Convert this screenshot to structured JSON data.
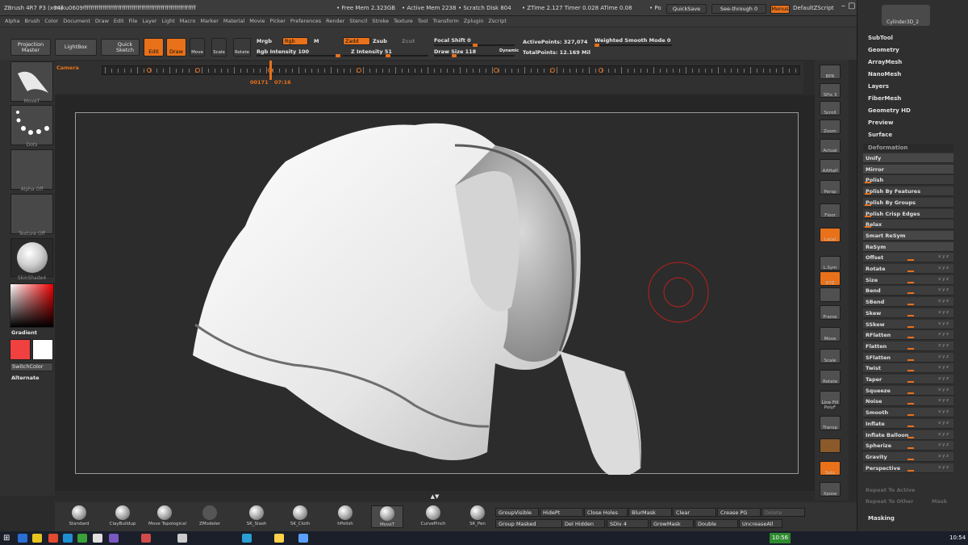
{
  "titlebar": {
    "app": "ZBrush 4R7 P3 (x64)",
    "doc": "miku0609ffffffffffffffffffffffffffffffffffffffffffffffffffffffffff",
    "free_mem": "• Free Mem 2.323GB",
    "active_mem": "• Active Mem 2238",
    "scratch": "• Scratch Disk 804",
    "ztime": "• ZTime 2.127 Timer 0.028 ATime 0.08",
    "po": "• Po",
    "quicksave": "QuickSave",
    "seethrough": "See-through  0",
    "menus": "Menus",
    "defaultzscript": "DefaultZScript",
    "tool_name": "Cylinder3D_2"
  },
  "menubar": [
    "Alpha",
    "Brush",
    "Color",
    "Document",
    "Draw",
    "Edit",
    "File",
    "Layer",
    "Light",
    "Macro",
    "Marker",
    "Material",
    "Movie",
    "Picker",
    "Preferences",
    "Render",
    "Stencil",
    "Stroke",
    "Texture",
    "Tool",
    "Transform",
    "Zplugin",
    "Zscript"
  ],
  "shelf": {
    "projection_master": "Projection Master",
    "lightbox": "LightBox",
    "quick_sketch": "Quick Sketch",
    "edit": "Edit",
    "draw": "Draw",
    "move": "Move",
    "scale": "Scale",
    "rotate": "Rotate",
    "mrgb": "Mrgb",
    "rgb": "Rgb",
    "m": "M",
    "rgb_intensity": "Rgb Intensity 100",
    "zadd": "Zadd",
    "zsub": "Zsub",
    "zcut": "Zcut",
    "z_intensity": "Z Intensity 51",
    "focal_shift": "Focal Shift 0",
    "draw_size": "Draw Size 118",
    "dynamic": "Dynamic",
    "active_points": "ActivePoints: 327,074",
    "total_points": "TotalPoints: 12.169 Mil",
    "weighted_smooth": "Weighted Smooth Mode 0"
  },
  "timeline": {
    "camera": "Camera",
    "frame": "00171",
    "time": "07:16"
  },
  "left": {
    "brush_cap": "MoveT",
    "stroke_cap": "Dots",
    "alpha_cap": "Alpha Off",
    "texture_cap": "Texture Off",
    "material_cap": "SkinShade4",
    "gradient": "Gradient",
    "switchcolor": "SwitchColor",
    "alternate": "Alternate"
  },
  "right_strip": [
    "BPR",
    "SPix 3",
    "Scroll",
    "Zoom",
    "Actual",
    "AAHalf",
    "Persp",
    "Floor",
    "Local",
    "L.Sym",
    "XYZ",
    "",
    "Frame",
    "Move",
    "Scale",
    "Rotate",
    "Line Fill PolyF",
    "Transp",
    "",
    "Solo",
    "Xpose"
  ],
  "tray": {
    "top": [
      "SubTool",
      "Geometry",
      "ArrayMesh",
      "NanoMesh",
      "Layers",
      "FiberMesh",
      "Geometry HD",
      "Preview",
      "Surface"
    ],
    "deformation": "Deformation",
    "rows": [
      "Unify",
      "Mirror",
      "Polish",
      "Polish By Features",
      "Polish By Groups",
      "Polish Crisp Edges",
      "Relax",
      "Smart ReSym",
      "ReSym",
      "Offset",
      "Rotate",
      "Size",
      "Bend",
      "SBend",
      "Skew",
      "SSkew",
      "RFlatten",
      "Flatten",
      "SFlatten",
      "Twist",
      "Taper",
      "Squeeze",
      "Noise",
      "Smooth",
      "Inflate",
      "Inflate Balloon",
      "Spherize",
      "Gravity",
      "Perspective"
    ],
    "axis_mark": "x y z",
    "repeat_active": "Repeat To Active",
    "repeat_other": "Repeat To Other",
    "mask": "Mask",
    "masking": "Masking"
  },
  "brushes": [
    "Standard",
    "ClayBuildup",
    "Move Topological",
    "ZModeler",
    "SK_Slash",
    "SK_Cloth",
    "hPolish",
    "MoveT",
    "CurvePinch",
    "SK_Pen"
  ],
  "groups": {
    "group_visible": "GroupVisible",
    "hide_pt": "HidePt",
    "close_holes": "Close Holes",
    "blur_mask": "BlurMask",
    "clear": "Clear",
    "crease_pg": "Crease PG",
    "delete": "Delete",
    "group_masked": "Group Masked",
    "del_hidden": "Del Hidden",
    "sdiv": "SDiv 4",
    "grow_mask": "GrowMask",
    "double": "Double",
    "uncrease_all": "UncreaseAll"
  },
  "taskbar": {
    "clock_badge": "10:56",
    "time": "10:54"
  },
  "colors": {
    "accent": "#e8711a",
    "bg": "#2b2b2b",
    "brush_ring": "#b8201f"
  }
}
